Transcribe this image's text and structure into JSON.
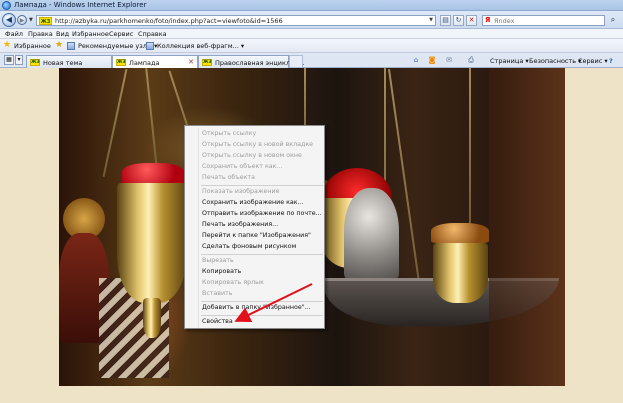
{
  "window": {
    "title": "Лампада - Windows Internet Explorer"
  },
  "address_bar": {
    "url": "http://azbyka.ru/parkhomenko/foto/index.php?act=viewfoto&id=1566",
    "site_badge": "ЖЗ",
    "search_placeholder": "Яndex",
    "search_logo": "Я"
  },
  "menu_bar": {
    "items": [
      "Файл",
      "Правка",
      "Вид",
      "Избранное",
      "Сервис",
      "Справка"
    ]
  },
  "favorites_bar": {
    "favorites_label": "Избранное",
    "suggested_sites": "Рекомендуемые узлы ▾",
    "web_slices": "Коллекция веб-фрагм... ▾"
  },
  "tabs": {
    "items": [
      {
        "label": "Новая тема",
        "badge": "ЖЗ"
      },
      {
        "label": "Лампада",
        "badge": "ЖЗ"
      },
      {
        "label": "Православная энциклоп...",
        "badge": "ЖЗ"
      }
    ]
  },
  "command_bar": {
    "page": "Страница ▾",
    "safety": "Безопасность ▾",
    "tools": "Сервис ▾",
    "help": "?"
  },
  "context_menu": {
    "items": [
      {
        "label": "Открыть ссылку",
        "enabled": false
      },
      {
        "label": "Открыть ссылку в новой вкладке",
        "enabled": false
      },
      {
        "label": "Открыть ссылку в новом окне",
        "enabled": false
      },
      {
        "label": "Сохранить объект как...",
        "enabled": false
      },
      {
        "label": "Печать объекта",
        "enabled": false
      },
      {
        "label": "Показать изображение",
        "enabled": false
      },
      {
        "label": "Сохранить изображение как...",
        "enabled": true
      },
      {
        "label": "Отправить изображение по почте...",
        "enabled": true
      },
      {
        "label": "Печать изображения...",
        "enabled": true
      },
      {
        "label": "Перейти к папке \"Изображения\"",
        "enabled": true
      },
      {
        "label": "Сделать фоновым рисунком",
        "enabled": true
      },
      {
        "label": "Вырезать",
        "enabled": false
      },
      {
        "label": "Копировать",
        "enabled": true
      },
      {
        "label": "Копировать ярлык",
        "enabled": false
      },
      {
        "label": "Вставить",
        "enabled": false
      },
      {
        "label": "Добавить в папку \"Избранное\"...",
        "enabled": true
      },
      {
        "label": "Свойства",
        "enabled": true
      }
    ]
  },
  "colors": {
    "arrow": "#e0111a",
    "menu_disabled": "#9d9d9d",
    "menu_enabled": "#111111"
  }
}
